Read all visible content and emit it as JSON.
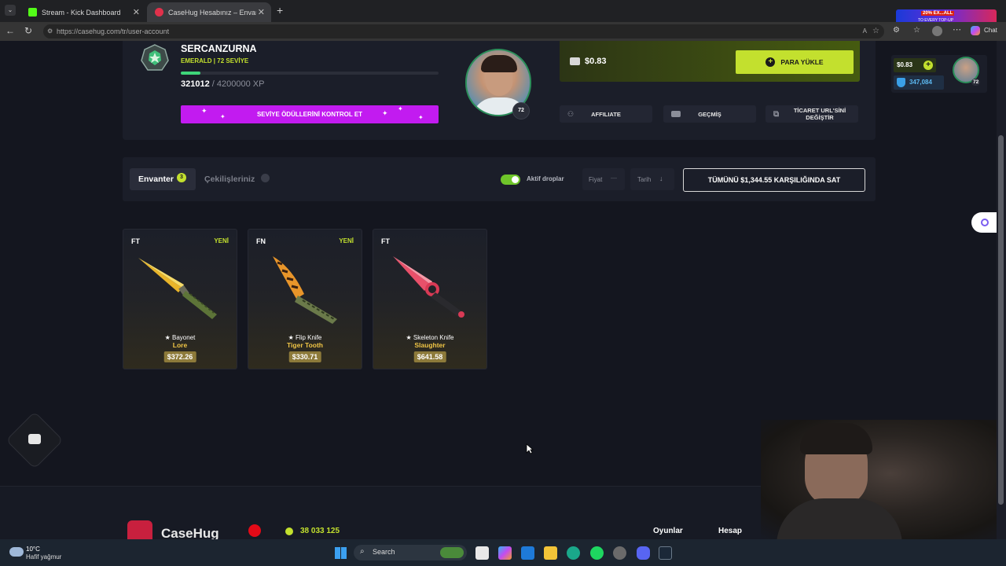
{
  "browser": {
    "tabs": [
      {
        "label": "Stream - Kick Dashboard",
        "active": false
      },
      {
        "label": "CaseHug Hesabınız – Envanter ve",
        "active": true
      }
    ],
    "url": "https://casehug.com/tr/user-account",
    "ad_text": "20% EX...ALL",
    "ad_sub": "TO EVERY TOP-UP",
    "chat_label": "Chat"
  },
  "profile": {
    "username": "SERCANZURNA",
    "rank_label": "EMERALD | 72 SEVİYE",
    "xp_current": "321012",
    "xp_total": "/ 4200000 XP",
    "xp_progress": 0.076,
    "level_badge": "72",
    "rewards_button": "SEVİYE ÖDÜLLERİNİ KONTROL ET"
  },
  "wallet": {
    "balance": "$0.83",
    "topup_label": "PARA YÜKLE"
  },
  "actions": {
    "affiliate": "AFFILIATE",
    "history": "GEÇMİŞ",
    "trade_url": "TİCARET URL'SİNİ DEĞİŞTİR"
  },
  "header_user": {
    "balance": "$0.83",
    "coins": "347,084",
    "level": "72"
  },
  "inventory": {
    "tab_inventory": "Envanter",
    "tab_inventory_count": "3",
    "tab_withdrawals": "Çekilişleriniz",
    "toggle_label": "Aktif droplar",
    "sort_price": "Fiyat",
    "sort_date": "Tarih",
    "sell_all": "TÜMÜNÜ $1,344.55 KARŞILIĞINDA SAT",
    "items": [
      {
        "condition": "FT",
        "badge": "YENİ",
        "name": "★ Bayonet",
        "skin": "Lore",
        "price": "$372.26"
      },
      {
        "condition": "FN",
        "badge": "YENİ",
        "name": "★ Flip Knife",
        "skin": "Tiger Tooth",
        "price": "$330.71"
      },
      {
        "condition": "FT",
        "badge": "",
        "name": "★ Skeleton Knife",
        "skin": "Slaughter",
        "price": "$641.58"
      }
    ]
  },
  "footer": {
    "brand": "CaseHug",
    "online_count": "38 033 125",
    "link_games": "Oyunlar",
    "link_account": "Hesap"
  },
  "taskbar": {
    "temp": "10°C",
    "weather": "Hafif yağmur",
    "search": "Search"
  },
  "colors": {
    "accent_green": "#c3e02e",
    "accent_purple": "#c21bf0",
    "page_bg": "#14161f"
  }
}
